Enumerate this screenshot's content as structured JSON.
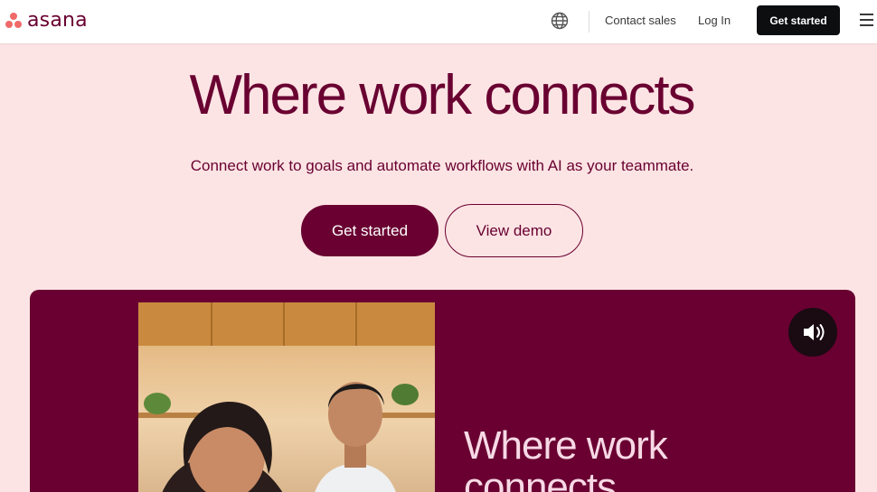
{
  "brand": {
    "name": "asana",
    "accent": "#f06a6a",
    "primary": "#690031"
  },
  "nav": {
    "globe_icon": "globe-icon",
    "contact_sales": "Contact sales",
    "log_in": "Log In",
    "cta": "Get started",
    "menu_icon": "hamburger-icon"
  },
  "hero": {
    "title": "Where work connects",
    "subtitle": "Connect work to goals and automate workflows with AI as your teammate.",
    "primary_button": "Get started",
    "secondary_button": "View demo"
  },
  "video": {
    "title": "Where work connects",
    "sound_icon": "volume-icon"
  }
}
